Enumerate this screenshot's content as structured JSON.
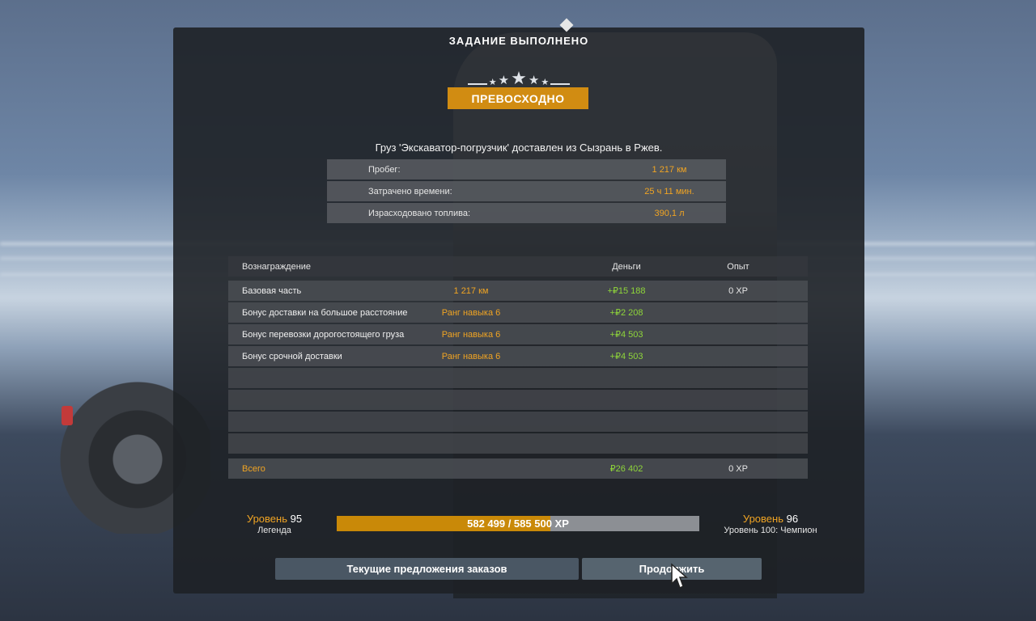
{
  "title": "ЗАДАНИЕ ВЫПОЛНЕНО",
  "rating": {
    "label": "ПРЕВОСХОДНО",
    "stars": 5
  },
  "cargo_description": "Груз 'Экскаватор-погрузчик' доставлен из Сызрань в Ржев.",
  "stats": [
    {
      "label": "Пробег:",
      "value": "1 217 км"
    },
    {
      "label": "Затрачено времени:",
      "value": "25 ч 11 мин."
    },
    {
      "label": "Израсходовано топлива:",
      "value": "390,1 л"
    }
  ],
  "rewards": {
    "headers": {
      "name": "Вознаграждение",
      "money": "Деньги",
      "xp": "Опыт"
    },
    "rows": [
      {
        "name": "Базовая часть",
        "detail": "1 217 км",
        "money": "+₽15 188",
        "xp": "0 XP"
      },
      {
        "name": "Бонус доставки на большое расстояние",
        "detail": "Ранг навыка 6",
        "money": "+₽2 208",
        "xp": ""
      },
      {
        "name": "Бонус перевозки дорогостоящего груза",
        "detail": "Ранг навыка 6",
        "money": "+₽4 503",
        "xp": ""
      },
      {
        "name": "Бонус срочной доставки",
        "detail": "Ранг навыка 6",
        "money": "+₽4 503",
        "xp": ""
      }
    ],
    "total": {
      "name": "Всего",
      "money": "₽26 402",
      "xp": "0 XP"
    }
  },
  "level": {
    "word": "Уровень",
    "current": "95",
    "current_title": "Легенда",
    "next": "96",
    "next_note": "Уровень 100: Чемпион",
    "xp_text": "582 499 / 585 500 XP",
    "progress": 0.59
  },
  "buttons": {
    "offers": "Текущие предложения заказов",
    "continue": "Продолжить"
  },
  "colors": {
    "accent": "#f0a423",
    "money": "#8fd63a",
    "badge": "#d18c12"
  }
}
